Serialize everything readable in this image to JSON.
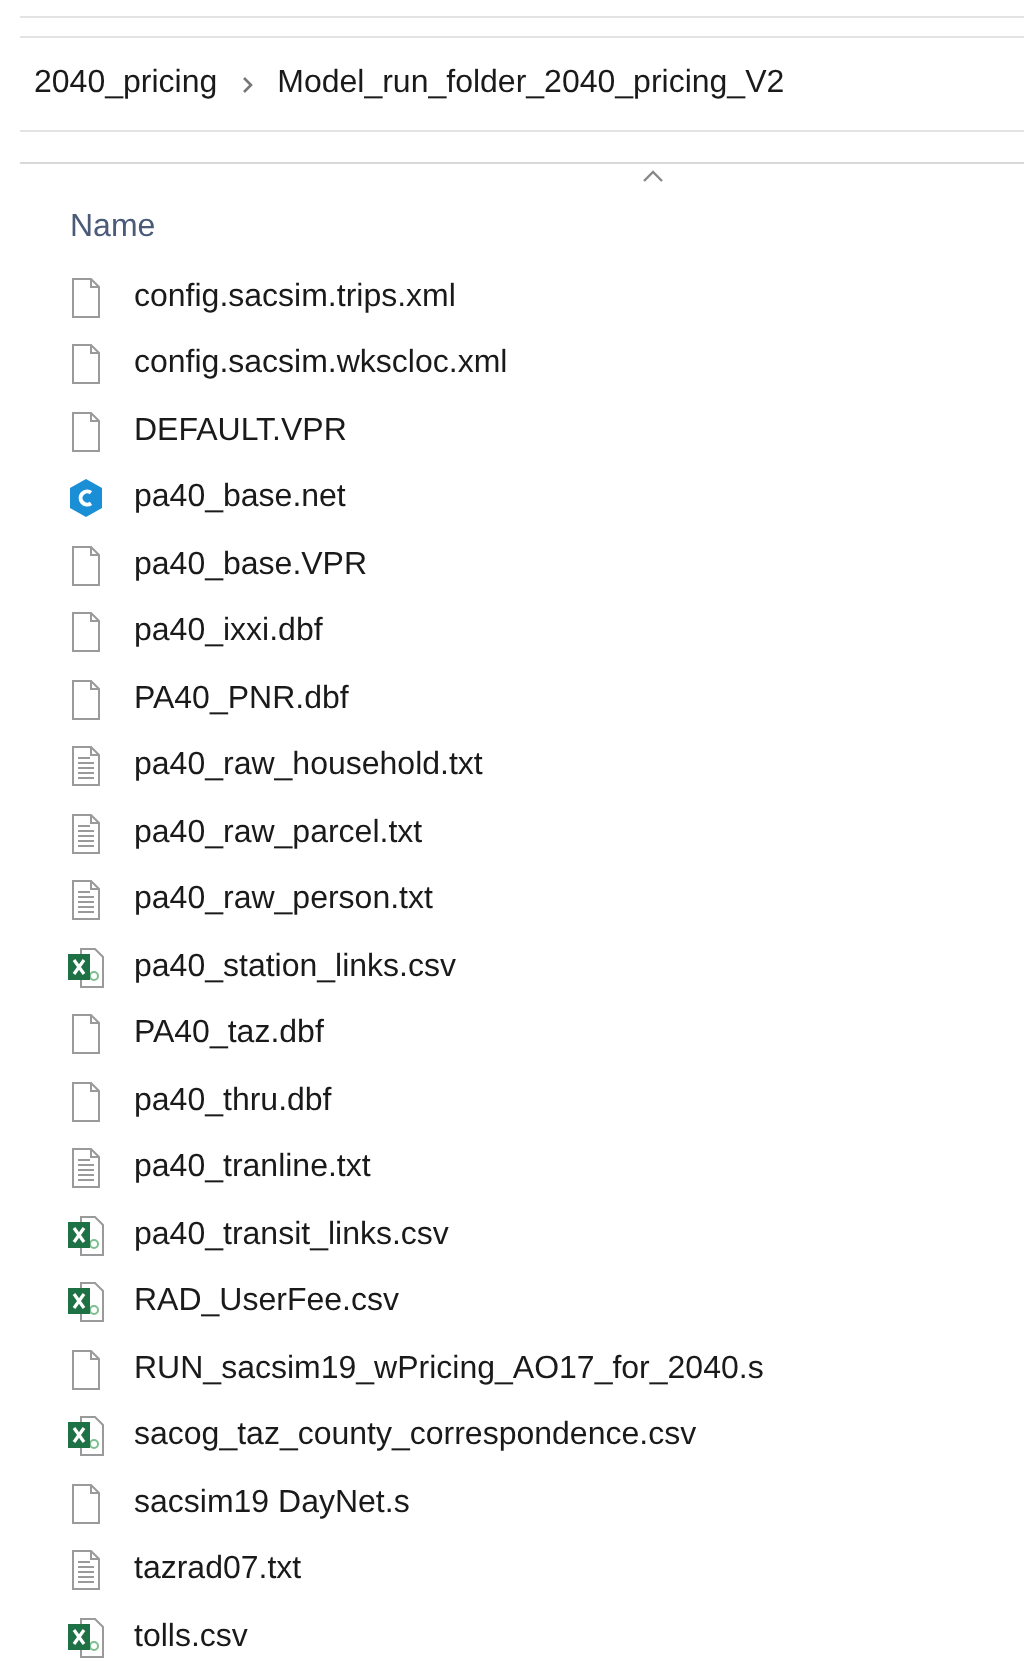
{
  "breadcrumb": [
    {
      "label": "2040_pricing"
    },
    {
      "label": "Model_run_folder_2040_pricing_V2"
    }
  ],
  "column_header": {
    "label": "Name"
  },
  "files": [
    {
      "name": "config.sacsim.trips.xml",
      "kind": "blank"
    },
    {
      "name": "config.sacsim.wkscloc.xml",
      "kind": "blank"
    },
    {
      "name": "DEFAULT.VPR",
      "kind": "blank"
    },
    {
      "name": "pa40_base.net",
      "kind": "app"
    },
    {
      "name": "pa40_base.VPR",
      "kind": "blank"
    },
    {
      "name": "pa40_ixxi.dbf",
      "kind": "blank"
    },
    {
      "name": "PA40_PNR.dbf",
      "kind": "blank"
    },
    {
      "name": "pa40_raw_household.txt",
      "kind": "text"
    },
    {
      "name": "pa40_raw_parcel.txt",
      "kind": "text"
    },
    {
      "name": "pa40_raw_person.txt",
      "kind": "text"
    },
    {
      "name": "pa40_station_links.csv",
      "kind": "excel"
    },
    {
      "name": "PA40_taz.dbf",
      "kind": "blank"
    },
    {
      "name": "pa40_thru.dbf",
      "kind": "blank"
    },
    {
      "name": "pa40_tranline.txt",
      "kind": "text"
    },
    {
      "name": "pa40_transit_links.csv",
      "kind": "excel"
    },
    {
      "name": "RAD_UserFee.csv",
      "kind": "excel"
    },
    {
      "name": "RUN_sacsim19_wPricing_AO17_for_2040.s",
      "kind": "blank"
    },
    {
      "name": "sacog_taz_county_correspondence.csv",
      "kind": "excel"
    },
    {
      "name": "sacsim19 DayNet.s",
      "kind": "blank"
    },
    {
      "name": "tazrad07.txt",
      "kind": "text"
    },
    {
      "name": "tolls.csv",
      "kind": "excel"
    }
  ]
}
